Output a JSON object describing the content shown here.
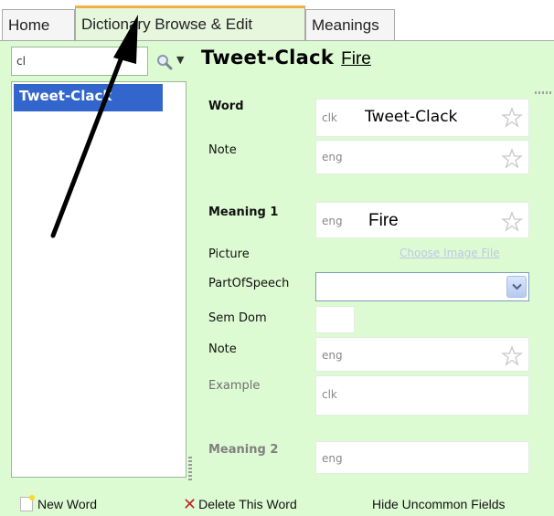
{
  "tabs": [
    {
      "label": "Home"
    },
    {
      "label": "Dictionary Browse & Edit",
      "selected": true
    },
    {
      "label": "Meanings"
    }
  ],
  "search": {
    "value": "cl"
  },
  "word_list": [
    "Tweet-Clack"
  ],
  "header": {
    "word": "Tweet-Clack",
    "meaning": "Fire"
  },
  "fields": {
    "word": {
      "label": "Word",
      "ws": "clk",
      "value": "Tweet-Clack"
    },
    "note": {
      "label": "Note",
      "ws": "eng",
      "value": ""
    },
    "meaning1": {
      "label": "Meaning 1",
      "ws": "eng",
      "value": "Fire"
    },
    "picture": {
      "label": "Picture",
      "link": "Choose Image File"
    },
    "pos": {
      "label": "PartOfSpeech",
      "value": ""
    },
    "semdom": {
      "label": "Sem Dom"
    },
    "note2": {
      "label": "Note",
      "ws": "eng"
    },
    "example": {
      "label": "Example",
      "ws": "clk"
    },
    "meaning2": {
      "label": "Meaning 2",
      "ws": "eng"
    }
  },
  "bottom": {
    "new_word": "New Word",
    "delete_word": "Delete This Word",
    "hide_fields": "Hide Uncommon Fields"
  },
  "colors": {
    "panel_bg": "#ddfbd2",
    "selection": "#3366cc",
    "tab_accent": "#f0b048",
    "delete_red": "#c0262b"
  },
  "icons": {
    "search": "search-icon",
    "star": "star-icon",
    "dropdown": "chevron-down-icon",
    "new": "new-word-icon",
    "delete": "delete-x-icon",
    "annotation": "arrow-annotation"
  }
}
